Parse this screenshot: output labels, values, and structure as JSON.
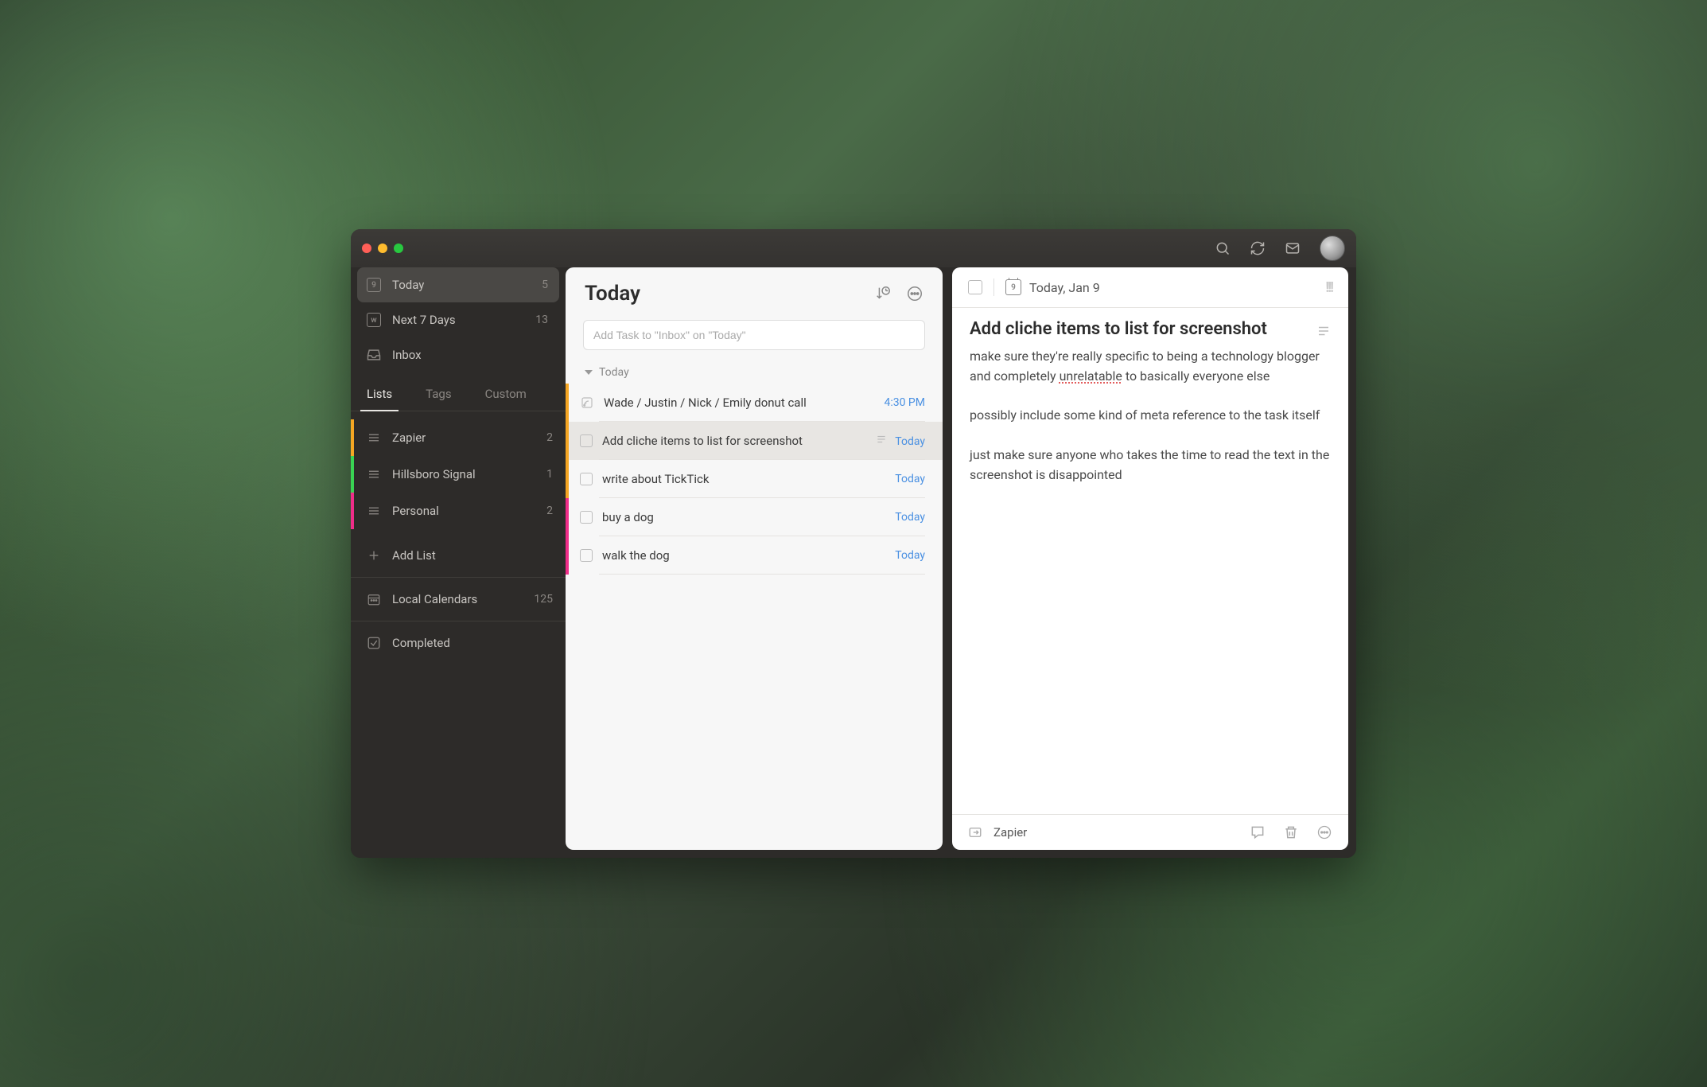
{
  "titlebar": {
    "icons": [
      "search",
      "refresh",
      "mail",
      "avatar"
    ]
  },
  "sidebar": {
    "smart": [
      {
        "id": "today",
        "label": "Today",
        "count": 5,
        "icon": "calendar-day",
        "day": "9",
        "selected": true
      },
      {
        "id": "next7",
        "label": "Next 7 Days",
        "count": 13,
        "icon": "calendar-week",
        "day": "w"
      },
      {
        "id": "inbox",
        "label": "Inbox",
        "count": "",
        "icon": "inbox"
      }
    ],
    "tabs": {
      "lists": "Lists",
      "tags": "Tags",
      "custom": "Custom",
      "active": "lists"
    },
    "lists": [
      {
        "id": "zapier",
        "label": "Zapier",
        "count": 2,
        "color": "#f5a623"
      },
      {
        "id": "hillsboro",
        "label": "Hillsboro Signal",
        "count": 1,
        "color": "#39d353"
      },
      {
        "id": "personal",
        "label": "Personal",
        "count": 2,
        "color": "#ef2d89"
      }
    ],
    "add_list_label": "Add List",
    "calendars": {
      "label": "Local Calendars",
      "count": 125
    },
    "completed_label": "Completed"
  },
  "list_panel": {
    "title": "Today",
    "add_task_placeholder": "Add Task to \"Inbox\" on \"Today\"",
    "group_label": "Today",
    "tasks": [
      {
        "type": "event",
        "title": "Wade / Justin / Nick / Emily donut call",
        "meta": "4:30 PM",
        "color": "#f5a623",
        "has_note": false
      },
      {
        "type": "task",
        "title": "Add cliche items to list for screenshot",
        "meta": "Today",
        "color": "#f5a623",
        "has_note": true,
        "selected": true
      },
      {
        "type": "task",
        "title": "write about TickTick",
        "meta": "Today",
        "color": "#f5a623",
        "has_note": false
      },
      {
        "type": "task",
        "title": "buy a dog",
        "meta": "Today",
        "color": "#ef2d89",
        "has_note": false
      },
      {
        "type": "task",
        "title": "walk the dog",
        "meta": "Today",
        "color": "#ef2d89",
        "has_note": false
      }
    ]
  },
  "detail": {
    "due": {
      "day": "9",
      "label": "Today, Jan 9"
    },
    "title": "Add cliche items to list for screenshot",
    "description_parts": [
      "make sure they're really specific to being a technology blogger and completely ",
      {
        "text": "unrelatable",
        "spell": true
      },
      " to basically everyone else\n\npossibly include some kind of meta reference to the task itself\n\njust make sure anyone who takes the time to read the text in the screenshot is disappointed"
    ],
    "project": "Zapier"
  }
}
